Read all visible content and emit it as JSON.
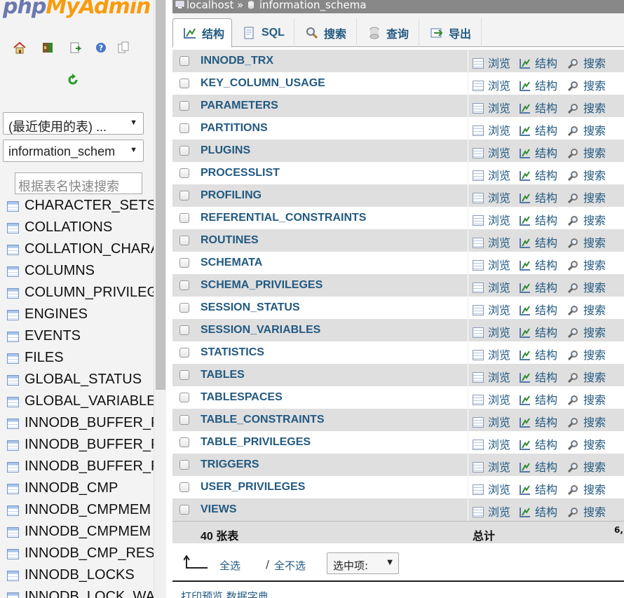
{
  "logo": {
    "part1": "php",
    "part2": "MyAdmin"
  },
  "nav": {
    "icons": [
      "home-icon",
      "exit-icon",
      "sql-query-icon",
      "help-icon",
      "copy-icon"
    ],
    "reload_icon": "reload-icon",
    "recent_select": "(最近使用的表) ...",
    "db_select": "information_schem",
    "filter_placeholder": "根据表名快速搜索",
    "tables": [
      "CHARACTER_SETS",
      "COLLATIONS",
      "COLLATION_CHARA",
      "COLUMNS",
      "COLUMN_PRIVILEG",
      "ENGINES",
      "EVENTS",
      "FILES",
      "GLOBAL_STATUS",
      "GLOBAL_VARIABLES",
      "INNODB_BUFFER_P",
      "INNODB_BUFFER_P",
      "INNODB_BUFFER_P",
      "INNODB_CMP",
      "INNODB_CMPMEM",
      "INNODB_CMPMEM",
      "INNODB_CMP_RESE",
      "INNODB_LOCKS",
      "INNODB_LOCK_WA"
    ]
  },
  "breadcrumb": {
    "server": "localhost",
    "separator": "»",
    "database": "information_schema"
  },
  "tabs": [
    {
      "label": "结构",
      "icon": "structure-icon"
    },
    {
      "label": "SQL",
      "icon": "sql-icon"
    },
    {
      "label": "搜索",
      "icon": "search-icon"
    },
    {
      "label": "查询",
      "icon": "query-icon"
    },
    {
      "label": "导出",
      "icon": "export-icon"
    }
  ],
  "actions": {
    "browse": "浏览",
    "structure": "结构",
    "search": "搜索"
  },
  "tables": [
    "INNODB_TRX",
    "KEY_COLUMN_USAGE",
    "PARAMETERS",
    "PARTITIONS",
    "PLUGINS",
    "PROCESSLIST",
    "PROFILING",
    "REFERENTIAL_CONSTRAINTS",
    "ROUTINES",
    "SCHEMATA",
    "SCHEMA_PRIVILEGES",
    "SESSION_STATUS",
    "SESSION_VARIABLES",
    "STATISTICS",
    "TABLES",
    "TABLESPACES",
    "TABLE_CONSTRAINTS",
    "TABLE_PRIVILEGES",
    "TRIGGERS",
    "USER_PRIVILEGES",
    "VIEWS"
  ],
  "summary": {
    "count": "40 张表",
    "total": "总计",
    "size": "6,"
  },
  "footer": {
    "check_all": "全选",
    "separator": "/",
    "uncheck_all": "全不选",
    "with_selected": "选中项:",
    "below_text": "打印预览   数据字典"
  },
  "colors": {
    "link": "#235a81",
    "row_odd": "#dfdfdf",
    "topbar": "#888888"
  }
}
